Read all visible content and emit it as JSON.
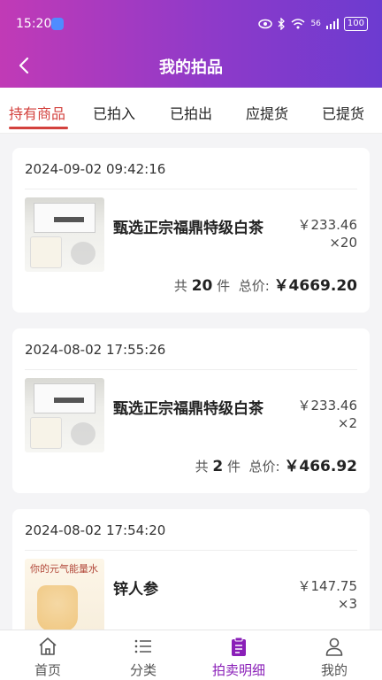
{
  "status": {
    "time": "15:20",
    "network": "56",
    "battery": "100"
  },
  "nav": {
    "title": "我的拍品"
  },
  "tabs": [
    {
      "label": "持有商品",
      "active": true
    },
    {
      "label": "已拍入",
      "active": false
    },
    {
      "label": "已拍出",
      "active": false
    },
    {
      "label": "应提货",
      "active": false
    },
    {
      "label": "已提货",
      "active": false
    }
  ],
  "orders": [
    {
      "date": "2024-09-02 09:42:16",
      "name": "甄选正宗福鼎特级白茶",
      "price": "￥233.46",
      "qty": "×20",
      "count_prefix": "共",
      "count": "20",
      "count_suffix": "件",
      "total_label": "总价:",
      "total": "￥4669.20"
    },
    {
      "date": "2024-08-02 17:55:26",
      "name": "甄选正宗福鼎特级白茶",
      "price": "￥233.46",
      "qty": "×2",
      "count_prefix": "共",
      "count": "2",
      "count_suffix": "件",
      "total_label": "总价:",
      "total": "￥466.92"
    },
    {
      "date": "2024-08-02 17:54:20",
      "name": "锌人参",
      "price": "￥147.75",
      "qty": "×3",
      "image_text": "你的元气能量水"
    }
  ],
  "bottom_nav": [
    {
      "label": "首页",
      "icon": "home-icon"
    },
    {
      "label": "分类",
      "icon": "list-icon"
    },
    {
      "label": "拍卖明细",
      "icon": "clipboard-icon",
      "active": true
    },
    {
      "label": "我的",
      "icon": "user-icon"
    }
  ],
  "colors": {
    "accent": "#d3413d",
    "header_start": "#c13ab6",
    "header_end": "#6c3bd0",
    "nav_active": "#8a1fb8"
  }
}
